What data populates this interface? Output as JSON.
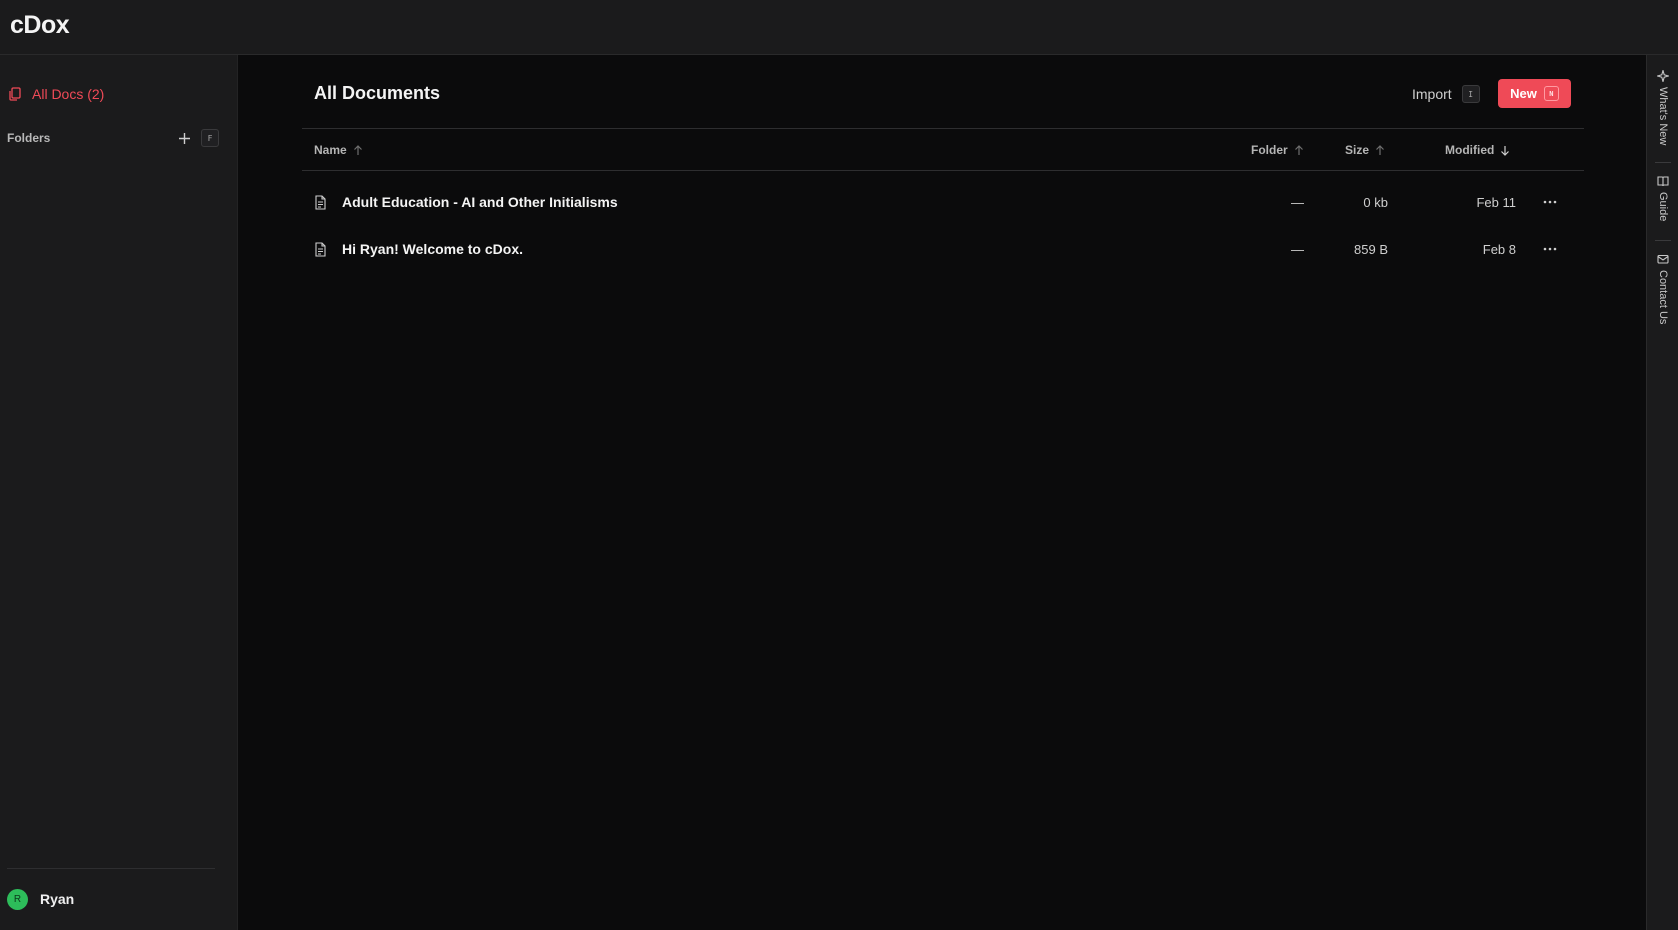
{
  "app": {
    "logo": "cDox"
  },
  "sidebar": {
    "all_docs_label": "All Docs (2)",
    "folders_label": "Folders",
    "folders_shortcut": "F",
    "user": {
      "initial": "R",
      "name": "Ryan"
    }
  },
  "main": {
    "title": "All Documents",
    "import_label": "Import",
    "import_shortcut": "I",
    "new_label": "New",
    "new_shortcut": "N",
    "columns": {
      "name": "Name",
      "folder": "Folder",
      "size": "Size",
      "modified": "Modified"
    },
    "rows": [
      {
        "name": "Adult Education - AI and Other Initialisms",
        "folder": "—",
        "size": "0 kb",
        "modified": "Feb 11"
      },
      {
        "name": "Hi Ryan! Welcome to cDox.",
        "folder": "—",
        "size": "859 B",
        "modified": "Feb 8"
      }
    ]
  },
  "rail": {
    "whats_new": "What's New",
    "guide": "Guide",
    "contact": "Contact Us"
  },
  "colors": {
    "accent": "#ef4a57",
    "avatar": "#2dbd5a"
  }
}
